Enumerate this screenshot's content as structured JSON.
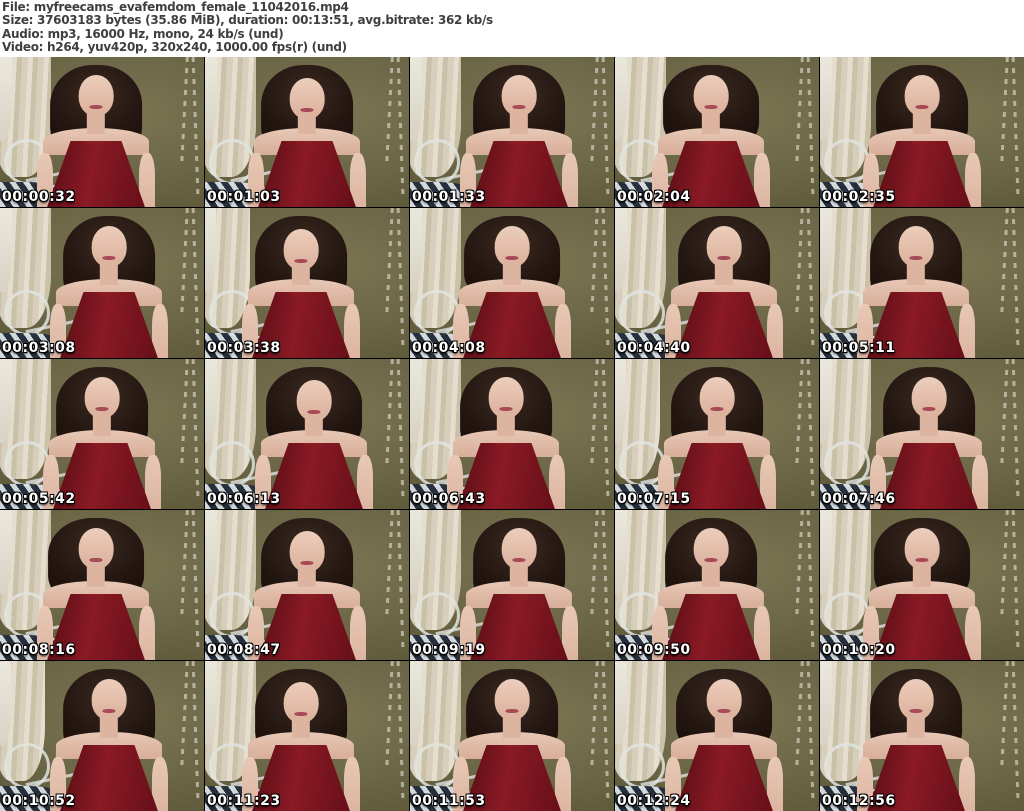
{
  "header": {
    "file_line": "File: myfreecams_evafemdom_female_11042016.mp4",
    "size_line": "Size: 37603183 bytes (35.86 MiB), duration: 00:13:51, avg.bitrate: 362 kb/s",
    "audio_line": "Audio: mp3, 16000 Hz, mono, 24 kb/s (und)",
    "video_line": "Video: h264, yuv420p, 320x240, 1000.00 fps(r) (und)"
  },
  "grid": {
    "columns": 5,
    "rows": 5,
    "timestamps": [
      "00:00:32",
      "00:01:03",
      "00:01:33",
      "00:02:04",
      "00:02:35",
      "00:03:08",
      "00:03:38",
      "00:04:08",
      "00:04:40",
      "00:05:11",
      "00:05:42",
      "00:06:13",
      "00:06:43",
      "00:07:15",
      "00:07:46",
      "00:08:16",
      "00:08:47",
      "00:09:19",
      "00:09:50",
      "00:10:20",
      "00:10:52",
      "00:11:23",
      "00:11:53",
      "00:12:24",
      "00:12:56"
    ]
  },
  "colors": {
    "header_bg": "#ffffff",
    "header_text": "#3f3f3f",
    "wall_olive": "#6b6646",
    "curtain_beige": "#ddd4c2",
    "dress_red": "#8a1a24",
    "hair_dark": "#241712",
    "skin": "#ddb4a0",
    "pillow_navy": "#232e3c",
    "timestamp_text": "#ffffff"
  }
}
